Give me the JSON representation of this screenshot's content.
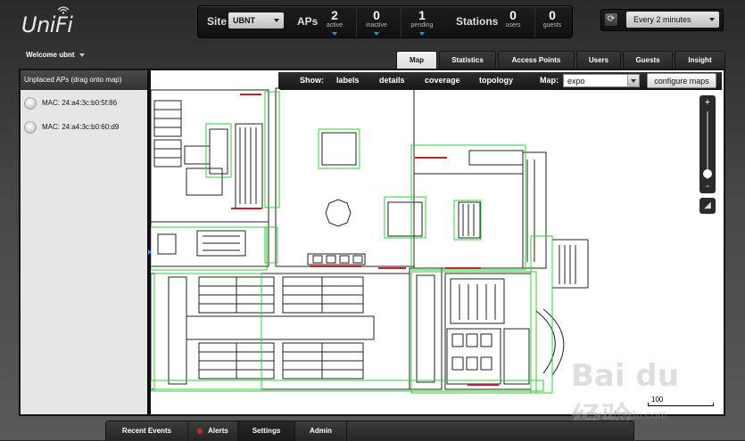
{
  "app": {
    "logo_text": "UniFi"
  },
  "topbar": {
    "site_label": "Site",
    "site_value": "UBNT",
    "aps_label": "APs",
    "aps": [
      {
        "value": "2",
        "label": "active"
      },
      {
        "value": "0",
        "label": "inactive"
      },
      {
        "value": "1",
        "label": "pending"
      }
    ],
    "stations_label": "Stations",
    "stations": [
      {
        "value": "0",
        "label": "users"
      },
      {
        "value": "0",
        "label": "guests"
      }
    ],
    "refresh_value": "Every 2 minutes"
  },
  "welcome": "Welcome ubnt",
  "tabs": [
    {
      "label": "Map",
      "active": true
    },
    {
      "label": "Statistics"
    },
    {
      "label": "Access Points"
    },
    {
      "label": "Users"
    },
    {
      "label": "Guests"
    },
    {
      "label": "Insight"
    }
  ],
  "left_panel": {
    "header": "Unplaced APs (drag onto map)",
    "items": [
      {
        "mac": "MAC: 24:a4:3c:b0:5f:86"
      },
      {
        "mac": "MAC: 24:a4:3c:b0:60:d9"
      }
    ]
  },
  "showbar": {
    "show_label": "Show:",
    "options": [
      "labels",
      "details",
      "coverage",
      "topology"
    ],
    "map_label": "Map:",
    "map_value": "expo",
    "configure_label": "configure maps"
  },
  "zoom": {
    "plus": "+",
    "minus": "-"
  },
  "scale": {
    "label": "100"
  },
  "bottom_tabs": [
    {
      "label": "Recent Events"
    },
    {
      "label": "Alerts"
    },
    {
      "label": "Settings",
      "active": true
    },
    {
      "label": "Admin"
    }
  ],
  "watermark": {
    "line1": "Bai du 经验",
    "line2": "jingyan.baidu.com"
  },
  "colors": {
    "accent": "#2d8ed8",
    "alert": "#c42c2c",
    "wall_red": "#cc2222",
    "zone_green": "#33cc33"
  }
}
